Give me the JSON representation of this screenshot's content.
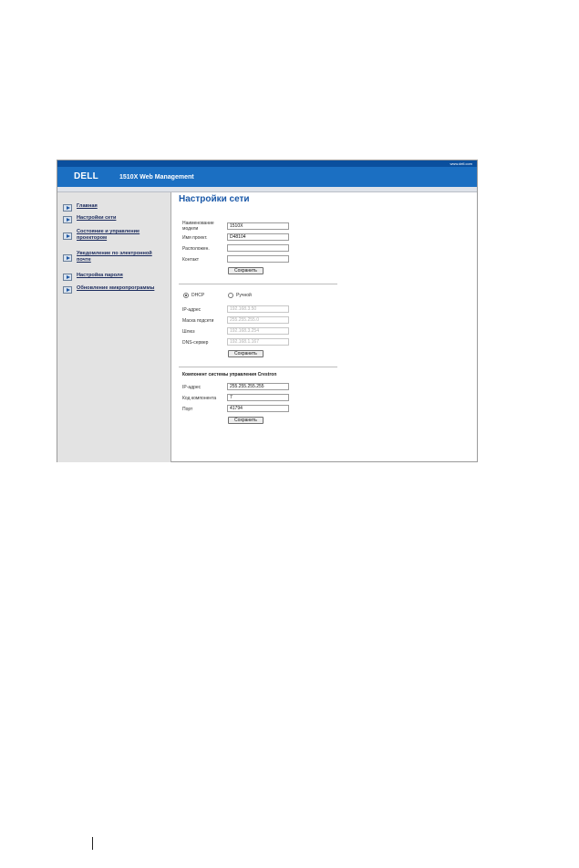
{
  "header": {
    "site_url": "www.dell.com",
    "logo_text": "DELL",
    "app_title": "1510X Web Management"
  },
  "sidebar": {
    "items": [
      {
        "label": "Главная"
      },
      {
        "label": "Настройки сети"
      },
      {
        "label": "Состояние и управление проектором"
      },
      {
        "label": "Уведомление по электронной почте"
      },
      {
        "label": "Настройка пароля"
      },
      {
        "label": "Обновление микропрограммы"
      }
    ]
  },
  "main": {
    "page_title": "Настройки сети",
    "general": {
      "model_name_label": "Наименование модели",
      "model_name_value": "1510X",
      "projector_name_label": "Имя проект.",
      "projector_name_value": "D48104",
      "location_label": "Расположен.",
      "location_value": "",
      "contact_label": "Контакт",
      "contact_value": "",
      "save_label": "Сохранить"
    },
    "network": {
      "dhcp_label": "DHCP",
      "manual_label": "Ручной",
      "ip_label": "IP-адрес",
      "ip_value": "192.168.3.50",
      "mask_label": "Маска подсети",
      "mask_value": "255.255.255.0",
      "gateway_label": "Шлюз",
      "gateway_value": "192.168.3.254",
      "dns_label": "DNS-сервер",
      "dns_value": "192.168.1.167",
      "save_label": "Сохранить"
    },
    "crestron": {
      "title": "Компонент системы управления Crestron",
      "ip_label": "IP-адрес",
      "ip_value": "255.255.255.255",
      "component_label": "Код компонента",
      "component_value": "7",
      "port_label": "Порт",
      "port_value": "41794",
      "save_label": "Сохранить"
    }
  },
  "colors": {
    "header_blue": "#1b6fc2",
    "title_blue": "#1a58a8"
  }
}
